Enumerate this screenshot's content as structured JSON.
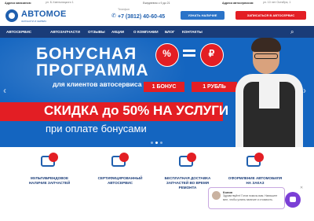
{
  "topbar": {
    "stores_label": "Адреса магазинов:",
    "stores_value": "ул. Б.Хмельницкого 1",
    "hours": "Ежедневно с 9 до 21",
    "service_label": "Адреса автосервисов:",
    "service_value": "ул. 10 лет Октября, 1"
  },
  "header": {
    "logo_name": "АВТОМОЕ",
    "logo_tag": "ЗАПЧАСТИ И СЕРВИС",
    "phone_label": "Телефон",
    "phone": "+7 (3812) 40-60-45",
    "btn_parts": "УЗНАТЬ НАЛИЧИЕ ЗАПЧАСТЕЙ",
    "btn_service": "ЗАПИСАТЬСЯ В АВТОСЕРВИС"
  },
  "nav": {
    "items": [
      "АВТОСЕРВИС",
      "АВТОЗАПЧАСТИ",
      "ОТЗЫВЫ",
      "АКЦИИ",
      "О КОМПАНИИ",
      "БЛОГ",
      "КОНТАКТЫ"
    ]
  },
  "hero": {
    "title_line1": "БОНУСНАЯ",
    "title_line2": "ПРОГРАММА",
    "title_line3": "для клиентов автосервиса",
    "coin1_symbol": "%",
    "coin2_symbol": "₽",
    "label1": "1 БОНУС",
    "label2": "1 РУБЛЬ",
    "promo": "СКИДКА до 50% НА УСЛУГИ",
    "sub": "при оплате бонусами",
    "slides": 3,
    "active_slide": 1
  },
  "features": [
    {
      "text": "МУЛЬТИБРЕНДОВОЕ НАЛИЧИЕ ЗАПЧАСТЕЙ"
    },
    {
      "text": "СЕРТИФИЦИРОВАННЫЙ АВТОСЕРВИС"
    },
    {
      "text": "БЕСПЛАТНАЯ ДОСТАВКА ЗАПЧАСТЕЙ ВО ВРЕМЯ РЕМОНТА"
    },
    {
      "text": "ОФОРМЛЕНИЕ АВТОМОБИЛЯ НА ЗАКАЗ"
    }
  ],
  "chat": {
    "name": "Колин",
    "message": "Здравствуйте! Готов помочь вам. Напишите мне, чтобы узнать наличие и стоимость."
  },
  "colors": {
    "brand_blue": "#1f5fae",
    "nav_blue": "#1a3c78",
    "hero_blue": "#1465c0",
    "red": "#e31e24",
    "chat_purple": "#7b3fd6"
  }
}
